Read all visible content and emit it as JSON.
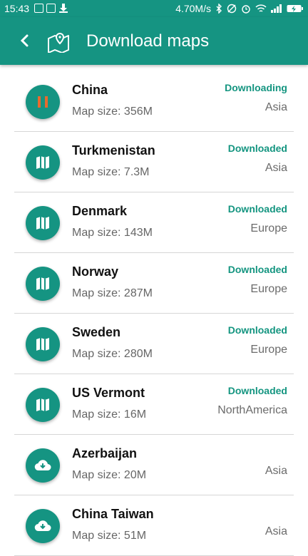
{
  "status_bar": {
    "time": "15:43",
    "speed": "4.70M/s"
  },
  "toolbar": {
    "title": "Download maps"
  },
  "colors": {
    "primary": "#159482",
    "pause_accent": "#e86a2e"
  },
  "countries": [
    {
      "name": "China",
      "size": "Map size: 356M",
      "status": "Downloading",
      "region": "Asia",
      "icon": "pause-icon"
    },
    {
      "name": "Turkmenistan",
      "size": "Map size: 7.3M",
      "status": "Downloaded",
      "region": "Asia",
      "icon": "map-icon"
    },
    {
      "name": "Denmark",
      "size": "Map size: 143M",
      "status": "Downloaded",
      "region": "Europe",
      "icon": "map-icon"
    },
    {
      "name": "Norway",
      "size": "Map size: 287M",
      "status": "Downloaded",
      "region": "Europe",
      "icon": "map-icon"
    },
    {
      "name": "Sweden",
      "size": "Map size: 280M",
      "status": "Downloaded",
      "region": "Europe",
      "icon": "map-icon"
    },
    {
      "name": "US Vermont",
      "size": "Map size:  16M",
      "status": "Downloaded",
      "region": "NorthAmerica",
      "icon": "map-icon"
    },
    {
      "name": "Azerbaijan",
      "size": "Map size:  20M",
      "status": "",
      "region": "Asia",
      "icon": "cloud-download-icon"
    },
    {
      "name": "China Taiwan",
      "size": "Map size:  51M",
      "status": "",
      "region": "Asia",
      "icon": "cloud-download-icon"
    }
  ]
}
